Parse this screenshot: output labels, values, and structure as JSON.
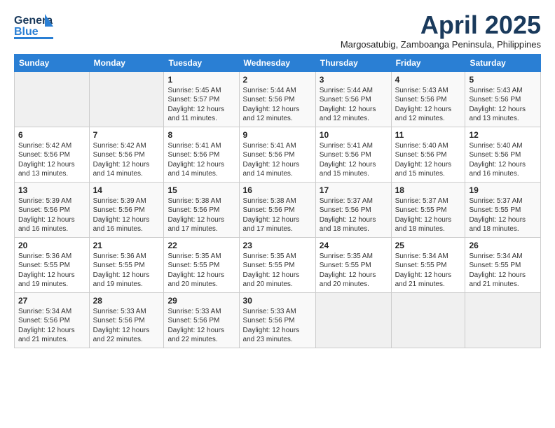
{
  "logo": {
    "line1": "General",
    "line2": "Blue"
  },
  "title": "April 2025",
  "subtitle": "Margosatubig, Zamboanga Peninsula, Philippines",
  "weekdays": [
    "Sunday",
    "Monday",
    "Tuesday",
    "Wednesday",
    "Thursday",
    "Friday",
    "Saturday"
  ],
  "weeks": [
    [
      {
        "day": "",
        "info": ""
      },
      {
        "day": "",
        "info": ""
      },
      {
        "day": "1",
        "info": "Sunrise: 5:45 AM\nSunset: 5:57 PM\nDaylight: 12 hours\nand 11 minutes."
      },
      {
        "day": "2",
        "info": "Sunrise: 5:44 AM\nSunset: 5:56 PM\nDaylight: 12 hours\nand 12 minutes."
      },
      {
        "day": "3",
        "info": "Sunrise: 5:44 AM\nSunset: 5:56 PM\nDaylight: 12 hours\nand 12 minutes."
      },
      {
        "day": "4",
        "info": "Sunrise: 5:43 AM\nSunset: 5:56 PM\nDaylight: 12 hours\nand 12 minutes."
      },
      {
        "day": "5",
        "info": "Sunrise: 5:43 AM\nSunset: 5:56 PM\nDaylight: 12 hours\nand 13 minutes."
      }
    ],
    [
      {
        "day": "6",
        "info": "Sunrise: 5:42 AM\nSunset: 5:56 PM\nDaylight: 12 hours\nand 13 minutes."
      },
      {
        "day": "7",
        "info": "Sunrise: 5:42 AM\nSunset: 5:56 PM\nDaylight: 12 hours\nand 14 minutes."
      },
      {
        "day": "8",
        "info": "Sunrise: 5:41 AM\nSunset: 5:56 PM\nDaylight: 12 hours\nand 14 minutes."
      },
      {
        "day": "9",
        "info": "Sunrise: 5:41 AM\nSunset: 5:56 PM\nDaylight: 12 hours\nand 14 minutes."
      },
      {
        "day": "10",
        "info": "Sunrise: 5:41 AM\nSunset: 5:56 PM\nDaylight: 12 hours\nand 15 minutes."
      },
      {
        "day": "11",
        "info": "Sunrise: 5:40 AM\nSunset: 5:56 PM\nDaylight: 12 hours\nand 15 minutes."
      },
      {
        "day": "12",
        "info": "Sunrise: 5:40 AM\nSunset: 5:56 PM\nDaylight: 12 hours\nand 16 minutes."
      }
    ],
    [
      {
        "day": "13",
        "info": "Sunrise: 5:39 AM\nSunset: 5:56 PM\nDaylight: 12 hours\nand 16 minutes."
      },
      {
        "day": "14",
        "info": "Sunrise: 5:39 AM\nSunset: 5:56 PM\nDaylight: 12 hours\nand 16 minutes."
      },
      {
        "day": "15",
        "info": "Sunrise: 5:38 AM\nSunset: 5:56 PM\nDaylight: 12 hours\nand 17 minutes."
      },
      {
        "day": "16",
        "info": "Sunrise: 5:38 AM\nSunset: 5:56 PM\nDaylight: 12 hours\nand 17 minutes."
      },
      {
        "day": "17",
        "info": "Sunrise: 5:37 AM\nSunset: 5:56 PM\nDaylight: 12 hours\nand 18 minutes."
      },
      {
        "day": "18",
        "info": "Sunrise: 5:37 AM\nSunset: 5:55 PM\nDaylight: 12 hours\nand 18 minutes."
      },
      {
        "day": "19",
        "info": "Sunrise: 5:37 AM\nSunset: 5:55 PM\nDaylight: 12 hours\nand 18 minutes."
      }
    ],
    [
      {
        "day": "20",
        "info": "Sunrise: 5:36 AM\nSunset: 5:55 PM\nDaylight: 12 hours\nand 19 minutes."
      },
      {
        "day": "21",
        "info": "Sunrise: 5:36 AM\nSunset: 5:55 PM\nDaylight: 12 hours\nand 19 minutes."
      },
      {
        "day": "22",
        "info": "Sunrise: 5:35 AM\nSunset: 5:55 PM\nDaylight: 12 hours\nand 20 minutes."
      },
      {
        "day": "23",
        "info": "Sunrise: 5:35 AM\nSunset: 5:55 PM\nDaylight: 12 hours\nand 20 minutes."
      },
      {
        "day": "24",
        "info": "Sunrise: 5:35 AM\nSunset: 5:55 PM\nDaylight: 12 hours\nand 20 minutes."
      },
      {
        "day": "25",
        "info": "Sunrise: 5:34 AM\nSunset: 5:55 PM\nDaylight: 12 hours\nand 21 minutes."
      },
      {
        "day": "26",
        "info": "Sunrise: 5:34 AM\nSunset: 5:55 PM\nDaylight: 12 hours\nand 21 minutes."
      }
    ],
    [
      {
        "day": "27",
        "info": "Sunrise: 5:34 AM\nSunset: 5:56 PM\nDaylight: 12 hours\nand 21 minutes."
      },
      {
        "day": "28",
        "info": "Sunrise: 5:33 AM\nSunset: 5:56 PM\nDaylight: 12 hours\nand 22 minutes."
      },
      {
        "day": "29",
        "info": "Sunrise: 5:33 AM\nSunset: 5:56 PM\nDaylight: 12 hours\nand 22 minutes."
      },
      {
        "day": "30",
        "info": "Sunrise: 5:33 AM\nSunset: 5:56 PM\nDaylight: 12 hours\nand 23 minutes."
      },
      {
        "day": "",
        "info": ""
      },
      {
        "day": "",
        "info": ""
      },
      {
        "day": "",
        "info": ""
      }
    ]
  ]
}
